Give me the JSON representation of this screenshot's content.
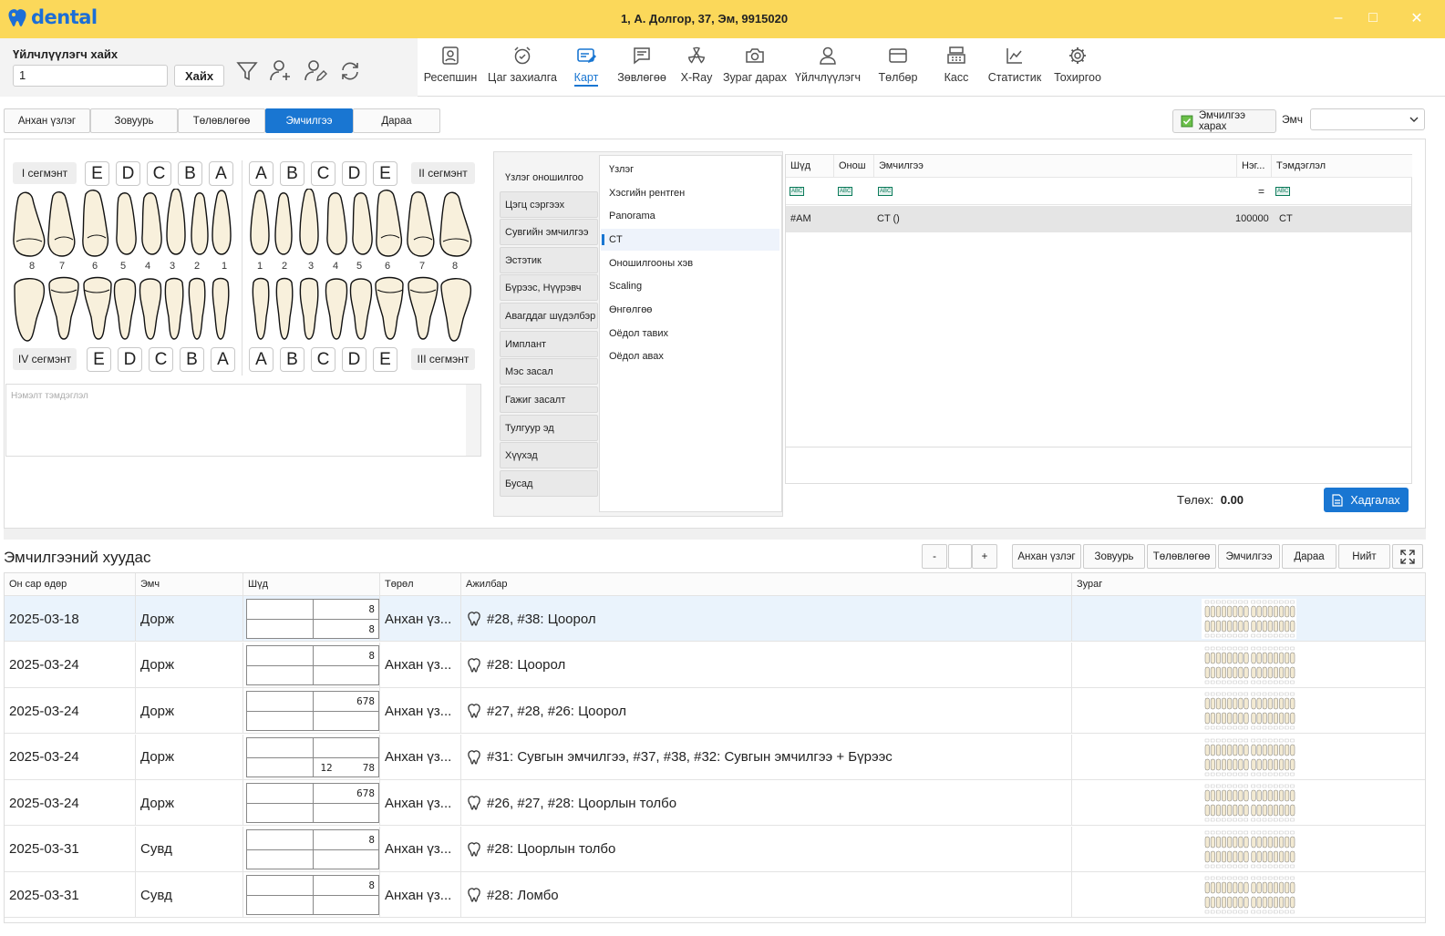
{
  "app": {
    "logo": "dental",
    "window_title": "1, А. Долгор, 37, Эм, 9915020"
  },
  "search": {
    "label": "Үйлчлүүлэгч хайх",
    "value": "1",
    "button": "Хайх"
  },
  "nav": [
    "Ресепшин",
    "Цаг захиалга",
    "Карт",
    "Зөвлөгөө",
    "X-Ray",
    "Зураг дарах",
    "Үйлчлүүлэгч",
    "Төлбөр",
    "Касс",
    "Статистик",
    "Тохиргоо"
  ],
  "nav_active": "Карт",
  "tabs": [
    "Анхан үзлэг",
    "Зовуурь",
    "Төлөвлөгөө",
    "Эмчилгээ",
    "Дараа"
  ],
  "tab_active": "Эмчилгээ",
  "emch_button": "Эмчилгээ харах",
  "emch_label": "Эмч",
  "teeth": {
    "seg1": "I сегмэнт",
    "seg2": "II сегмэнт",
    "seg3": "III сегмэнт",
    "seg4": "IV сегмэнт",
    "upper_left_letters": [
      "E",
      "D",
      "C",
      "B",
      "A"
    ],
    "upper_right_letters": [
      "A",
      "B",
      "C",
      "D",
      "E"
    ],
    "lower_left_letters": [
      "E",
      "D",
      "C",
      "B",
      "A"
    ],
    "lower_right_letters": [
      "A",
      "B",
      "C",
      "D",
      "E"
    ],
    "left_numbers": [
      "8",
      "7",
      "6",
      "5",
      "4",
      "3",
      "2",
      "1"
    ],
    "right_numbers": [
      "1",
      "2",
      "3",
      "4",
      "5",
      "6",
      "7",
      "8"
    ]
  },
  "notes_placeholder": "Нэмэлт тэмдэглэл",
  "categories": [
    "Үзлэг оношилгоо",
    "Цэгц сэргээх",
    "Сувгийн эмчилгээ",
    "Эстэтик",
    "Бүрээс, Нүүрэвч",
    "Авагддаг шүдэлбэр",
    "Имплант",
    "Мэс засал",
    "Гажиг засалт",
    "Тулгуур эд",
    "Хүүхэд",
    "Бусад"
  ],
  "subcategories": [
    "Үзлэг",
    "Хэсгийн рентген",
    "Panorama",
    "CT",
    "Оношилгооны хэв",
    "Scaling",
    "Өнгөлгөө",
    "Оёдол тавих",
    "Оёдол авах"
  ],
  "sub_selected": "CT",
  "grid": {
    "headers": [
      "Шүд",
      "Онош",
      "Эмчилгээ",
      "Нэг...",
      "Тэмдэглэл"
    ],
    "row": {
      "tooth": "#AM",
      "diag": "",
      "treatment": "CT ()",
      "price": "100000",
      "note": "CT"
    }
  },
  "total": {
    "label": "Төлөх:",
    "value": "0.00"
  },
  "save_button": "Хадгалах",
  "history": {
    "title": "Эмчилгээний хуудас",
    "zoom_minus": "-",
    "zoom_plus": "+",
    "filter_buttons": [
      "Анхан үзлэг",
      "Зовуурь",
      "Төлөвлөгөө",
      "Эмчилгээ",
      "Дараа",
      "Нийт"
    ],
    "headers": [
      "Он сар өдөр",
      "Эмч",
      "Шүд",
      "Төрөл",
      "Ажилбар",
      "Зураг"
    ],
    "rows": [
      {
        "date": "2025-03-18",
        "doctor": "Дорж",
        "q_tr": "8",
        "q_br": "8",
        "q_tl": "",
        "q_bl": "",
        "type": "Анхан үз...",
        "work": "#28, #38: Цоорол"
      },
      {
        "date": "2025-03-24",
        "doctor": "Дорж",
        "q_tr": "8",
        "q_br": "",
        "q_tl": "",
        "q_bl": "",
        "type": "Анхан үз...",
        "work": "#28: Цоорол"
      },
      {
        "date": "2025-03-24",
        "doctor": "Дорж",
        "q_tr": "678",
        "q_br": "",
        "q_tl": "",
        "q_bl": "",
        "type": "Анхан үз...",
        "work": "#27, #28, #26: Цоорол"
      },
      {
        "date": "2025-03-24",
        "doctor": "Дорж",
        "q_tr": "",
        "q_br": "12     78",
        "q_tl": "",
        "q_bl": "",
        "type": "Анхан үз...",
        "work": "#31: Сувгын эмчилгээ, #37, #38, #32: Сувгын эмчилгээ + Бүрээс"
      },
      {
        "date": "2025-03-24",
        "doctor": "Дорж",
        "q_tr": "678",
        "q_br": "",
        "q_tl": "",
        "q_bl": "",
        "type": "Анхан үз...",
        "work": "#26, #27, #28: Цоорлын толбо"
      },
      {
        "date": "2025-03-31",
        "doctor": "Сувд",
        "q_tr": "8",
        "q_br": "",
        "q_tl": "",
        "q_bl": "",
        "type": "Анхан үз...",
        "work": "#28: Цоорлын толбо"
      },
      {
        "date": "2025-03-31",
        "doctor": "Сувд",
        "q_tr": "8",
        "q_br": "",
        "q_tl": "",
        "q_bl": "",
        "type": "Анхан үз...",
        "work": "#28: Ломбо"
      }
    ]
  },
  "colors": {
    "titlebar": "#fbd85a",
    "accent": "#1976d2"
  }
}
